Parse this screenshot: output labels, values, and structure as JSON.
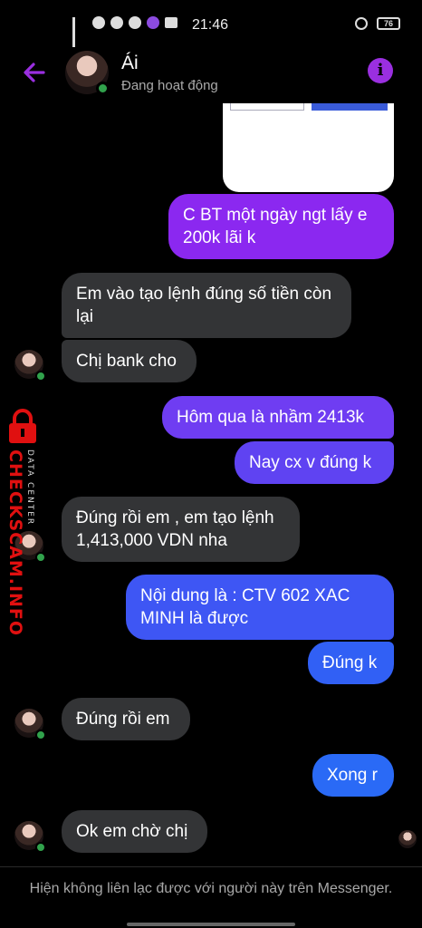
{
  "status": {
    "time": "21:46",
    "battery": "76"
  },
  "header": {
    "name": "Ái",
    "status": "Đang hoạt động"
  },
  "messages": [
    {
      "side": "out",
      "text": "C BT một ngày ngt lấy e 200k lãi k"
    },
    {
      "side": "in",
      "text": "Em vào tạo lệnh đúng số tiền còn lại"
    },
    {
      "side": "in",
      "text": "Chị bank cho"
    },
    {
      "side": "out",
      "text": "Hôm qua là nhầm 2413k"
    },
    {
      "side": "out",
      "text": "Nay cx v đúng k"
    },
    {
      "side": "in",
      "text": "Đúng rồi em , em tạo lệnh 1,413,000 VDN nha"
    },
    {
      "side": "out",
      "text": "Nội dung là : CTV 602 XAC MINH  là được"
    },
    {
      "side": "out",
      "text": "Đúng k"
    },
    {
      "side": "in",
      "text": "Đúng rồi em"
    },
    {
      "side": "out",
      "text": "Xong r"
    },
    {
      "side": "in",
      "text": "Ok em chờ chị"
    }
  ],
  "watermark": {
    "main": "CHECKSCAM.INFO",
    "sub": "DATA CENTER"
  },
  "footer": {
    "notice": "Hiện không liên lạc được với người này trên Messenger."
  },
  "colors": {
    "accent": "#9a2fe0",
    "incoming": "#333436",
    "online": "#31a24c"
  }
}
